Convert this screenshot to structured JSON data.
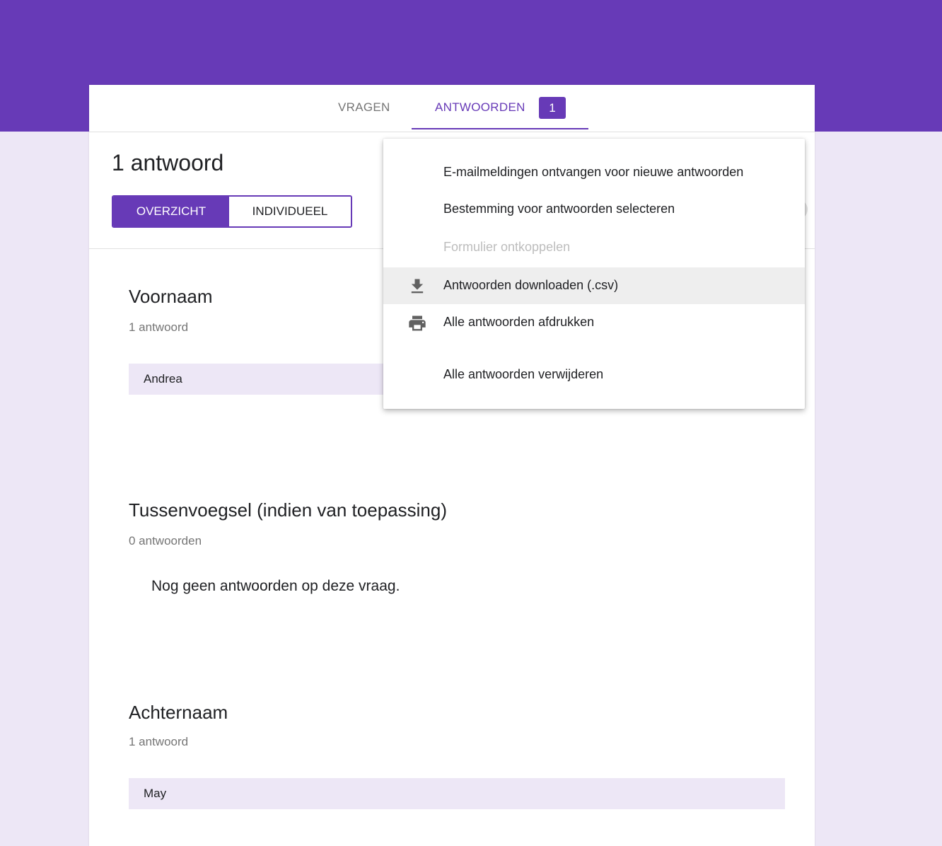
{
  "colors": {
    "accent": "#673ab7",
    "background": "#ede7f6",
    "answer_bg": "#ede7f6"
  },
  "tabs": {
    "questions_label": "VRAGEN",
    "responses_label": "ANTWOORDEN",
    "responses_badge": "1"
  },
  "summary": {
    "response_count": "1 antwoord",
    "view_toggle": {
      "summary_label": "OVERZICHT",
      "individual_label": "INDIVIDUEEL",
      "selected": "OVERZICHT"
    }
  },
  "questions": [
    {
      "title": "Voornaam",
      "count": "1 antwoord",
      "answers": [
        "Andrea"
      ]
    },
    {
      "title": "Tussenvoegsel (indien van toepassing)",
      "count": "0 antwoorden",
      "empty_message": "Nog geen antwoorden op deze vraag."
    },
    {
      "title": "Achternaam",
      "count": "1 antwoord",
      "answers": [
        "May"
      ]
    }
  ],
  "menu": {
    "items": [
      {
        "label": "E-mailmeldingen ontvangen voor nieuwe antwoorden",
        "icon": "",
        "disabled": false
      },
      {
        "label": "Bestemming voor antwoorden selecteren",
        "icon": "",
        "disabled": false
      },
      {
        "label": "Formulier ontkoppelen",
        "icon": "",
        "disabled": true
      },
      {
        "label": "Antwoorden downloaden (.csv)",
        "icon": "download-icon",
        "disabled": false,
        "highlighted": true
      },
      {
        "label": "Alle antwoorden afdrukken",
        "icon": "print-icon",
        "disabled": false
      },
      {
        "label": "Alle antwoorden verwijderen",
        "icon": "",
        "disabled": false
      }
    ]
  }
}
